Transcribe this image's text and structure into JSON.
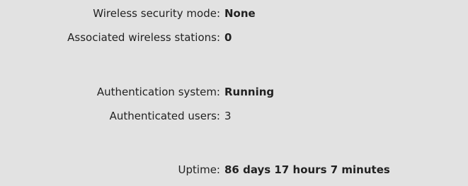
{
  "wireless": {
    "security_mode_label": "Wireless security mode:",
    "security_mode_value": "None",
    "associated_stations_label": "Associated wireless stations:",
    "associated_stations_value": "0"
  },
  "authentication": {
    "system_label": "Authentication system:",
    "system_value": "Running",
    "users_label": "Authenticated users:",
    "users_value": "3"
  },
  "uptime": {
    "label": "Uptime:",
    "value": "86 days 17 hours 7 minutes"
  }
}
